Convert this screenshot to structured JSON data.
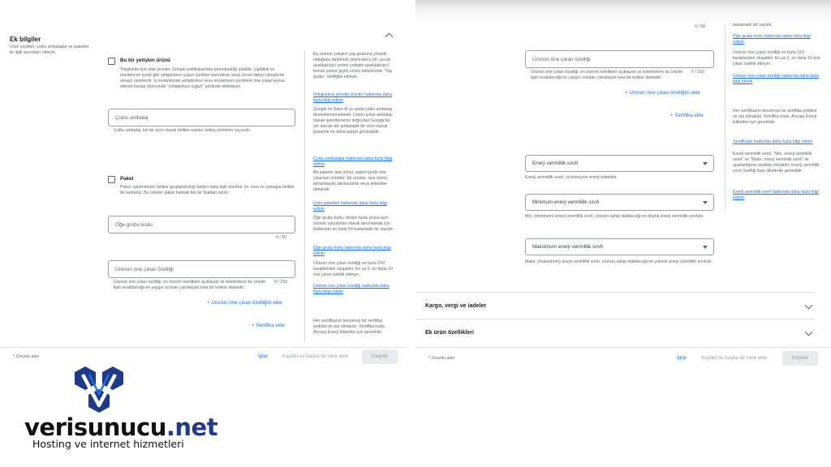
{
  "left": {
    "section_title": "Ek bilgiler",
    "section_desc": "Ürün çeşitleri, çoklu ambalajlar ve paketler ile ilgili ayrıntıları ekleyin.",
    "adult": {
      "label": "Bu bir yetişkin ürünü",
      "desc": "Yetişkinler için olan ürünler, Google politikalarında tanımlandığı şekilde, çıplaklık ve müstehcen içerik gibi yetişkinlere uygun içerikler barındıran veya cinsel ilişkiyi iyileştirme amaçlı ürünlerdir. İş modelinizde yetişkinlere veya müstehcen içeriklere öne çıkarılıyorsa sitenizi hesap düzeyinde \"yetişkinlere uygun\" şeklinde etiketleyin.",
      "help": "Bu ürünün yetişkin yaş grubuna yönelik olduğunu belirtmek istiyorsanız (ör. çocuk ayakkabıları yerine yetişkin ayakkabıları) bunun yerine giyim ürünü bölümünde \"Yaş grubu\" özelliğini ekleyin.",
      "help_link": "Yetişkinlere yönelik ürünler hakkında daha fazla bilgi edinin"
    },
    "multipack": {
      "placeholder": "Çoklu ambalaj",
      "desc": "Çoklu ambalaj, tek bir ürün olarak birlikte satılan özdeş ürünlerin sayısıdır.",
      "help": "Google ile Satın Al şu anda çoklu ambalajı desteklememektedir. Ürünü çoklu ambalajı olarak işaretlerseniz doğrudan Google'da yer alacak tek ambalajlık bir ürün olarak gösterilir ve daha pahalı görünebilir.",
      "help_link": "Çoklu ambalajlar hakkında daha fazla bilgi edinin"
    },
    "bundle": {
      "label": "Paket",
      "desc": "Paket, işletmenizin birlikte gruplandırdığı birden fazla ilgili üründür (ör. lens ve çantayla birlikte bir kamera). Bu ürünler paket halinde tek bir fiyattan satılır.",
      "help": "Bir paketin ana ürünü, paket içinde öne çıkarılan üründür. Ek ürünler, ana ürünü tamamlayan aksesuarlar veya eklentiler olmalıdır.",
      "help_link": "Ürün paketleri hakkında daha fazla bilgi edinin"
    },
    "item_group": {
      "placeholder": "Öğe grubu kodu",
      "counter": "0 / 50",
      "help": "Öğe grubu kodu, birden fazla ürünü aynı ürünün varyantları olarak tanımlamak için kullanılan en fazla 50 basamaklı bir sayıdır.",
      "help_link": "Öğe grubu kodu hakkında daha fazla bilgi edinin"
    },
    "highlight": {
      "placeholder": "Ürünün öne çıkan özelliği",
      "counter": "0 / 150",
      "desc": "Ürünün öne çıkan özelliği, en önemli özellikleri açıklayan ve tüketicilerin bu ürünle ilgili sorabileceği en yaygın soruları yanıtlayan kısa bir kelime listesidir.",
      "help": "Ürünün öne çıkan özelliği en fazla 150 karakterden oluşabilir. En az 2, en fazla 10 öne çıkan özellik ekleyin.",
      "help_link": "Ürünün öne çıkan özelliği hakkında daha fazla bilgi edinin",
      "add": "Ürünün öne çıkan özelliğini ekle"
    },
    "cert": {
      "add": "Sertifika ekle",
      "help": "Her sertifikanın benzersiz bir sertifika yetkilisi ve adı olmalıdır. Sertifika kodu, Avrupa Enerji Etiketleri için gereklidir."
    },
    "footer": {
      "required": "* Zorunlu alan",
      "cancel": "İptal",
      "save_add": "Kaydet ve başka bir tane ekle",
      "save": "Kaydet"
    }
  },
  "right": {
    "top_counter": "0 / 50",
    "top_help": "basamaklı bir sayıdır.",
    "top_help_link": "Öğe grubu kodu hakkında daha fazla bilgi edinin",
    "highlight": {
      "placeholder": "Ürünün öne çıkan özelliği",
      "counter": "0 / 150",
      "desc": "Ürünün öne çıkan özelliği, en önemli özellikleri açıklayan ve tüketicilerin bu ürünle ilgili sorabileceği en yaygın soruları yanıtlayan kısa bir kelime listesidir.",
      "help": "Ürünün öne çıkan özelliği en fazla 150 karakterden oluşabilir. En az 2, en fazla 10 öne çıkan özellik ekleyin.",
      "help_link": "Ürünün öne çıkan özelliği hakkında daha fazla bilgi edinin",
      "add": "Ürünün öne çıkan özelliğini ekle"
    },
    "cert": {
      "add": "Sertifika ekle",
      "help": "Her sertifikanın benzersiz bir sertifika yetkilisi ve adı olmalıdır. Sertifika kodu, Avrupa Enerji Etiketleri için gereklidir.",
      "help_link": "Sertifikalar hakkında daha fazla bilgi edinin"
    },
    "energy": {
      "label": "Enerji verimlilik sınıfı",
      "desc": "Enerji verimlilik sınıfı, ürününüzün enerji etiketidir.",
      "help": "Enerji verimlilik sınıfı, \"Min. enerji verimlilik sınıfı\" ve \"Maks. enerji verimlilik sınıfı\" ile ayarladığınız aralıkta olmalıdır. Enerji verimlilik sınıfı özelliği bazı ülkelerde gereklidir.",
      "help_link": "Enerji verimlilik sınıfı hakkında daha fazla bilgi edinin"
    },
    "min_energy": {
      "label": "Minimum enerji verimlilik sınıfı",
      "desc": "Min. (minimum) enerji verimlilik sınıfı, ürünün sahip olabileceği en düşük enerji verimlilik sınıfıdır."
    },
    "max_energy": {
      "label": "Maksimum enerji verimlilik sınıfı",
      "desc": "Maks. (maksimum) enerji verimlilik sınıfı, ürünün sahip olabileceği en yüksek enerji verimlilik sınıfıdır."
    },
    "shipping": "Kargo, vergi ve iadeler",
    "extra": "Ek ürün özellikleri",
    "footer": {
      "required": "* Zorunlu alan",
      "cancel": "İptal",
      "save_add": "Kaydet ve başka bir tane ekle",
      "save": "Kaydet"
    }
  },
  "logo": {
    "brand": "verisunucu",
    "tld": ".net",
    "tagline": "Hosting ve internet hizmetleri",
    "colors": {
      "primary": "#1f3a8a",
      "accent": "#1a73e8"
    }
  }
}
